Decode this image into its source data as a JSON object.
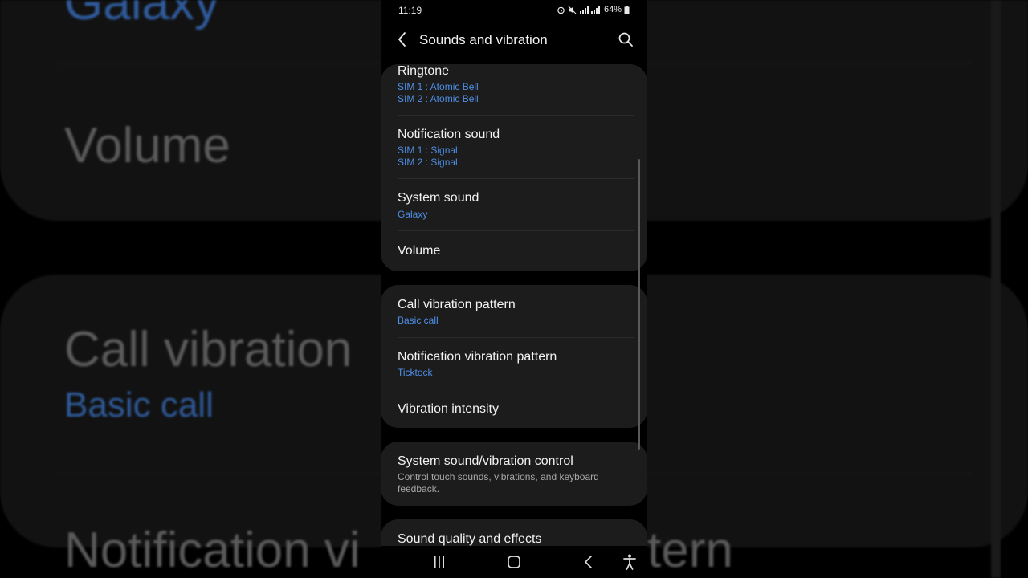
{
  "status_bar": {
    "time": "11:19",
    "battery": "64%",
    "icons": [
      "alarm-icon",
      "mute-icon",
      "signal-icon",
      "battery-icon"
    ]
  },
  "app_bar": {
    "title": "Sounds and vibration",
    "back_icon": "back-arrow-icon",
    "search_icon": "search-icon"
  },
  "settings": {
    "ringtone": {
      "label": "Ringtone",
      "sim1": "SIM 1 : Atomic Bell",
      "sim2": "SIM 2 : Atomic Bell"
    },
    "notification_sound": {
      "label": "Notification sound",
      "sim1": "SIM 1 : Signal",
      "sim2": "SIM 2 : Signal"
    },
    "system_sound": {
      "label": "System sound",
      "value": "Galaxy"
    },
    "volume": {
      "label": "Volume"
    },
    "call_vibration": {
      "label": "Call vibration pattern",
      "value": "Basic call"
    },
    "notification_vibration": {
      "label": "Notification vibration pattern",
      "value": "Ticktock"
    },
    "vibration_intensity": {
      "label": "Vibration intensity"
    },
    "system_control": {
      "label": "System sound/vibration control",
      "desc": "Control touch sounds, vibrations, and keyboard feedback."
    },
    "sound_quality": {
      "label": "Sound quality and effects"
    }
  },
  "background": {
    "galaxy": "Galaxy",
    "volume": "Volume",
    "call_vibration": "Call vibration",
    "basic_call": "Basic call",
    "notification_left": "Notification vi",
    "notification_right": "tern"
  },
  "navigation": [
    "recent-apps-icon",
    "home-icon",
    "back-icon",
    "accessibility-icon"
  ],
  "colors": {
    "accent": "#4f8fe6",
    "card": "#1c1c1c",
    "background": "#000000"
  }
}
